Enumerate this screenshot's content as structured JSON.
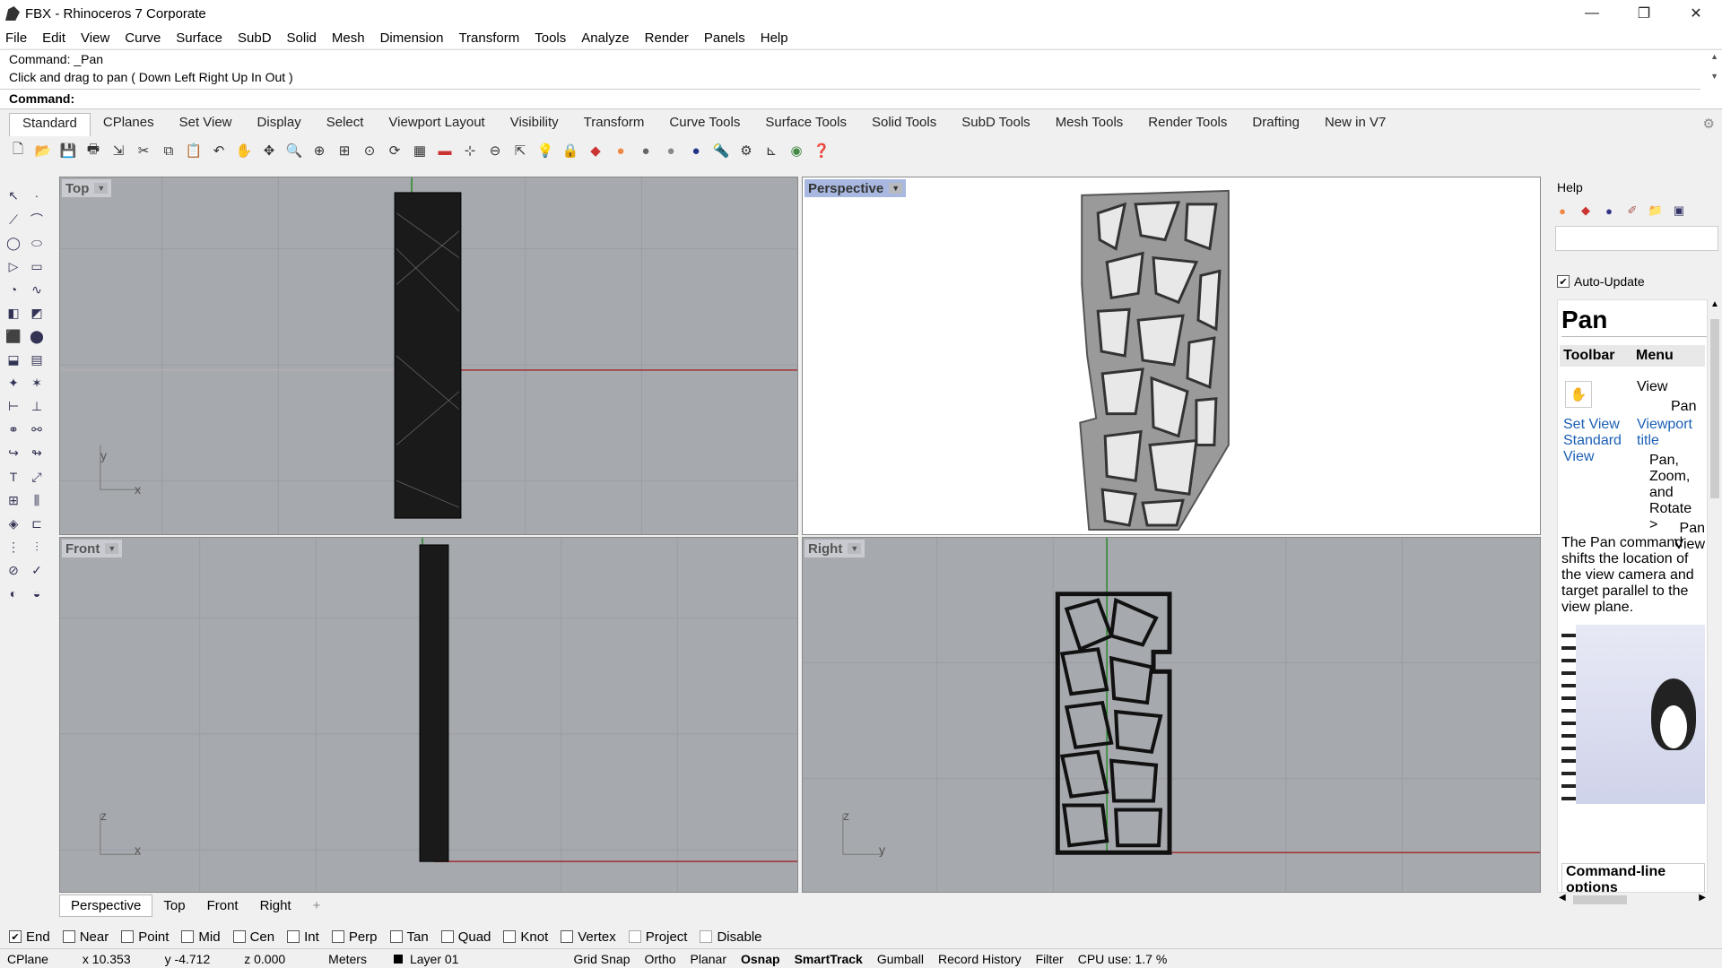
{
  "window": {
    "title": "FBX - Rhinoceros 7 Corporate",
    "min": "—",
    "max": "❐",
    "close": "✕"
  },
  "menu": [
    "File",
    "Edit",
    "View",
    "Curve",
    "Surface",
    "SubD",
    "Solid",
    "Mesh",
    "Dimension",
    "Transform",
    "Tools",
    "Analyze",
    "Render",
    "Panels",
    "Help"
  ],
  "command": {
    "history1": "Command: _Pan",
    "history2": "Click and drag to pan ( Down  Left  Right  Up  In  Out )",
    "prompt": "Command:"
  },
  "tabs": [
    "Standard",
    "CPlanes",
    "Set View",
    "Display",
    "Select",
    "Viewport Layout",
    "Visibility",
    "Transform",
    "Curve Tools",
    "Surface Tools",
    "Solid Tools",
    "SubD Tools",
    "Mesh Tools",
    "Render Tools",
    "Drafting",
    "New in V7"
  ],
  "viewports": {
    "top": "Top",
    "perspective": "Perspective",
    "front": "Front",
    "right": "Right"
  },
  "axes": {
    "top_y": "y",
    "top_x": "x",
    "front_z": "z",
    "front_x": "x",
    "right_z": "z",
    "right_y": "y"
  },
  "viewtabs": [
    "Perspective",
    "Top",
    "Front",
    "Right"
  ],
  "viewtab_add": "+",
  "osnaps": [
    {
      "label": "End",
      "checked": true
    },
    {
      "label": "Near",
      "checked": false
    },
    {
      "label": "Point",
      "checked": false
    },
    {
      "label": "Mid",
      "checked": false
    },
    {
      "label": "Cen",
      "checked": false
    },
    {
      "label": "Int",
      "checked": false
    },
    {
      "label": "Perp",
      "checked": false
    },
    {
      "label": "Tan",
      "checked": false
    },
    {
      "label": "Quad",
      "checked": false
    },
    {
      "label": "Knot",
      "checked": false
    },
    {
      "label": "Vertex",
      "checked": false
    },
    {
      "label": "Project",
      "checked": false,
      "disabled": true
    },
    {
      "label": "Disable",
      "checked": false,
      "disabled": true
    }
  ],
  "status": {
    "cplane": "CPlane",
    "x": "x 10.353",
    "y": "y -4.712",
    "z": "z 0.000",
    "units": "Meters",
    "layer": "Layer 01",
    "toggles": [
      "Grid Snap",
      "Ortho",
      "Planar",
      "Osnap",
      "SmartTrack",
      "Gumball",
      "Record History",
      "Filter"
    ],
    "cpu": "CPU use: 1.7 %"
  },
  "help": {
    "panel_title": "Help",
    "auto_update": "Auto-Update",
    "heading": "Pan",
    "col_toolbar": "Toolbar",
    "col_menu": "Menu",
    "menu_path": [
      "View",
      "Pan"
    ],
    "link1": "Set View Standard View",
    "link2": "Viewport title",
    "sub": "Pan, Zoom, and Rotate >",
    "sub2": "Pan View",
    "description": "The Pan command shifts the location of the view camera and target parallel to the view plane.",
    "cmd_options": "Command-line options"
  }
}
